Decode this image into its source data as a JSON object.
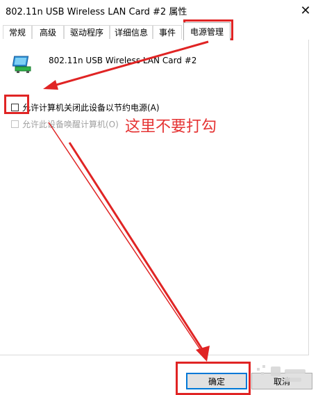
{
  "window": {
    "title": "802.11n USB Wireless LAN Card #2 属性",
    "close_glyph": "✕"
  },
  "tabs": [
    {
      "label": "常规"
    },
    {
      "label": "高级"
    },
    {
      "label": "驱动程序"
    },
    {
      "label": "详细信息"
    },
    {
      "label": "事件"
    },
    {
      "label": "电源管理",
      "active": true
    }
  ],
  "device": {
    "name": "802.11n USB Wireless LAN Card #2",
    "icon": "network-adapter-icon"
  },
  "options": {
    "allow_turn_off": {
      "label": "允许计算机关闭此设备以节约电源(A)",
      "checked": false
    },
    "allow_wake": {
      "label": "允许此设备唤醒计算机(O)",
      "checked": false,
      "disabled": true
    }
  },
  "annotation": {
    "text": "这里不要打勾",
    "color": "#e53333"
  },
  "buttons": {
    "ok": "确定",
    "cancel": "取消"
  },
  "colors": {
    "highlight": "#e02424",
    "accent": "#0078d7"
  }
}
